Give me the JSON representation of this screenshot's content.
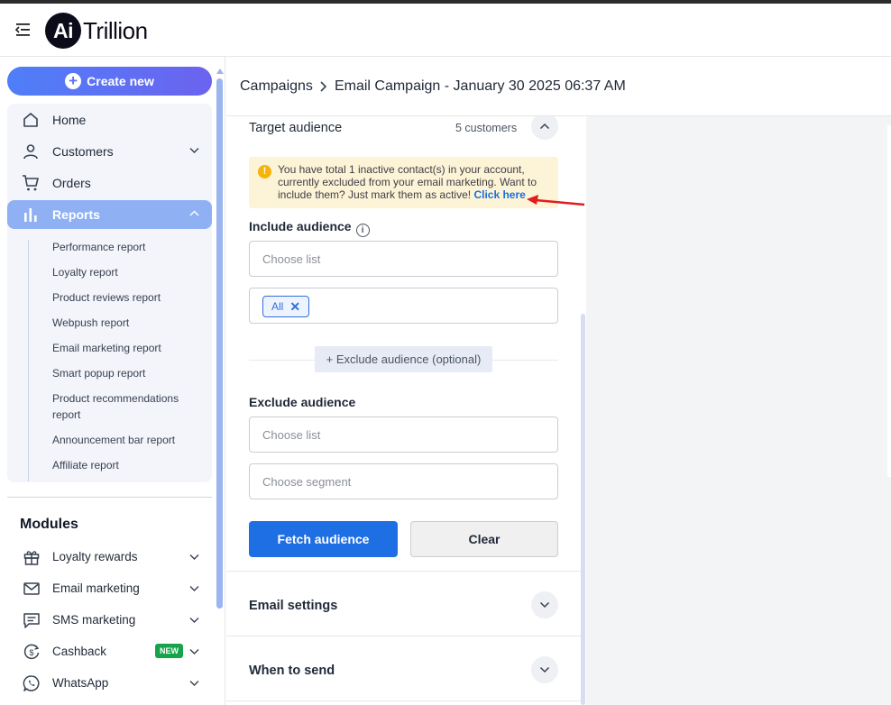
{
  "header": {
    "logo_mark": "Ai",
    "logo_text": "Trillion"
  },
  "sidebar": {
    "create_label": "Create new",
    "nav": [
      {
        "label": "Home",
        "icon": "home-icon"
      },
      {
        "label": "Customers",
        "icon": "user-icon"
      },
      {
        "label": "Orders",
        "icon": "cart-icon"
      },
      {
        "label": "Reports",
        "icon": "bar-chart-icon"
      }
    ],
    "reports_sub": [
      "Performance report",
      "Loyalty report",
      "Product reviews report",
      "Webpush report",
      "Email marketing report",
      "Smart popup report",
      "Product recommendations",
      "report",
      "Announcement bar report",
      "Affiliate report"
    ],
    "modules_title": "Modules",
    "modules": [
      {
        "label": "Loyalty rewards",
        "icon": "gift-icon"
      },
      {
        "label": "Email marketing",
        "icon": "mail-icon"
      },
      {
        "label": "SMS marketing",
        "icon": "sms-icon"
      },
      {
        "label": "Cashback",
        "icon": "cashback-icon",
        "badge": "NEW"
      },
      {
        "label": "WhatsApp",
        "icon": "whatsapp-icon"
      }
    ]
  },
  "breadcrumb": {
    "root": "Campaigns",
    "current": "Email Campaign - January 30 2025 06:37 AM"
  },
  "target": {
    "title": "Target audience",
    "count": "5 customers",
    "notice_text": "You have total 1 inactive contact(s) in your account, currently excluded from your email marketing. Want to include them? Just mark them as active!",
    "notice_link": "Click here",
    "include_label": "Include audience",
    "choose_list_placeholder": "Choose list",
    "tag_all": "All",
    "exclude_button": "+ Exclude audience (optional)",
    "exclude_label": "Exclude audience",
    "exclude_list_placeholder": "Choose list",
    "exclude_segment_placeholder": "Choose segment",
    "fetch_label": "Fetch audience",
    "clear_label": "Clear"
  },
  "sections": {
    "email_settings": "Email settings",
    "when_to_send": "When to send"
  },
  "colors": {
    "accent": "#1f6fe4",
    "active_nav": "#8fb1f4",
    "notice_bg": "#fdf3d7",
    "new_badge": "#16a34a",
    "annotation_arrow": "#e11d1d"
  }
}
